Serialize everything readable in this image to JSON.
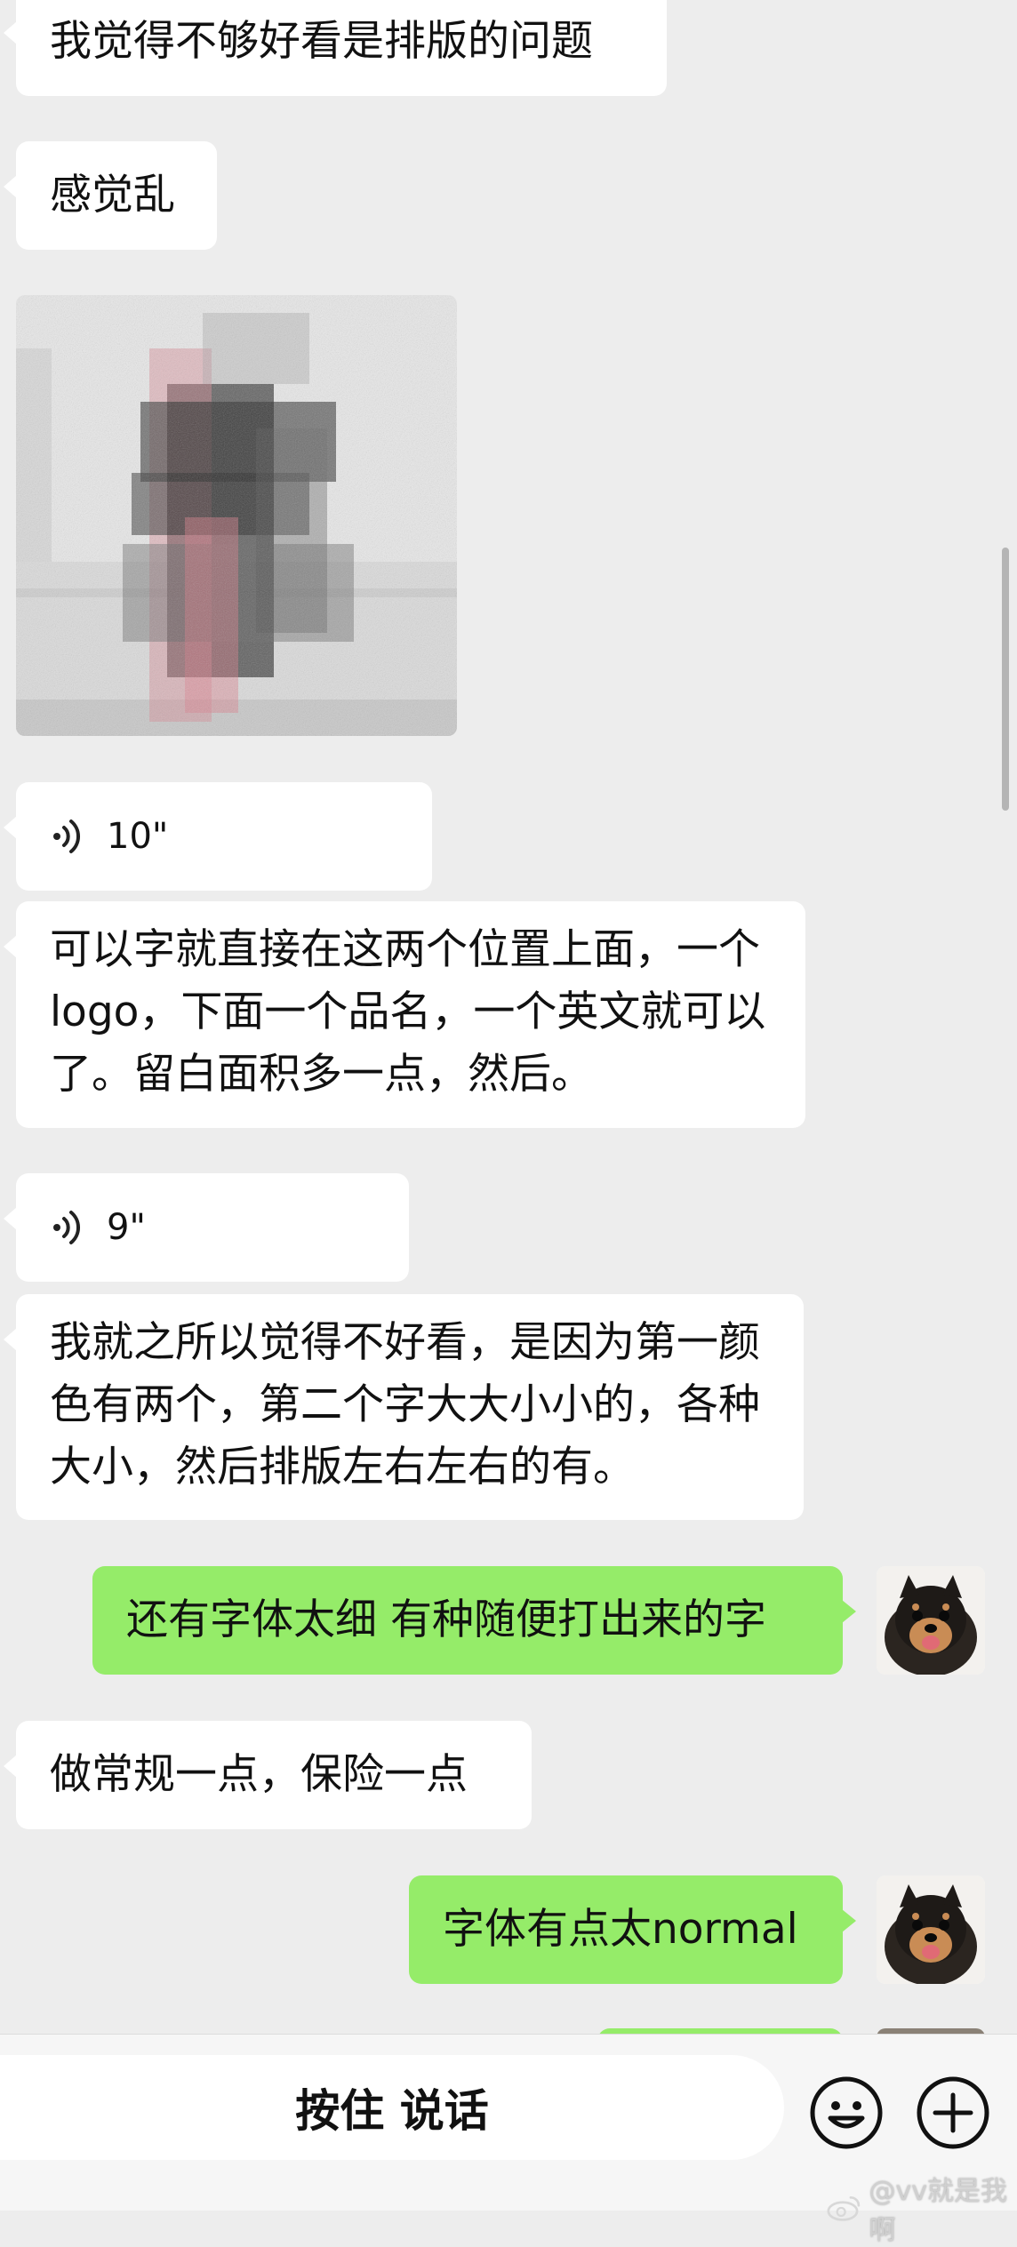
{
  "messages": {
    "m1_text": "我觉得不够好看是排版的问题",
    "m2_text": "感觉乱",
    "m4_duration": "10\"",
    "m5_text": "可以字就直接在这两个位置上面，一个logo，下面一个品名，一个英文就可以了。留白面积多一点，然后。",
    "m6_duration": "9\"",
    "m7_text": "我就之所以觉得不好看，是因为第一颜色有两个，第二个字大大小小的，各种大小，然后排版左右左右的有。",
    "m8_text": "还有字体太细 有种随便打出来的字",
    "m9_text": "做常规一点，保险一点",
    "m10_text": "字体有点太normal"
  },
  "input_bar": {
    "hold_to_talk": "按住 说话"
  },
  "watermark": {
    "text": "@vv就是我啊"
  },
  "colors": {
    "background": "#ededed",
    "incoming_bubble": "#ffffff",
    "outgoing_bubble": "#95ec69"
  },
  "icons": [
    "voice-wave-icon",
    "emoji-icon",
    "plus-icon",
    "weibo-icon"
  ]
}
